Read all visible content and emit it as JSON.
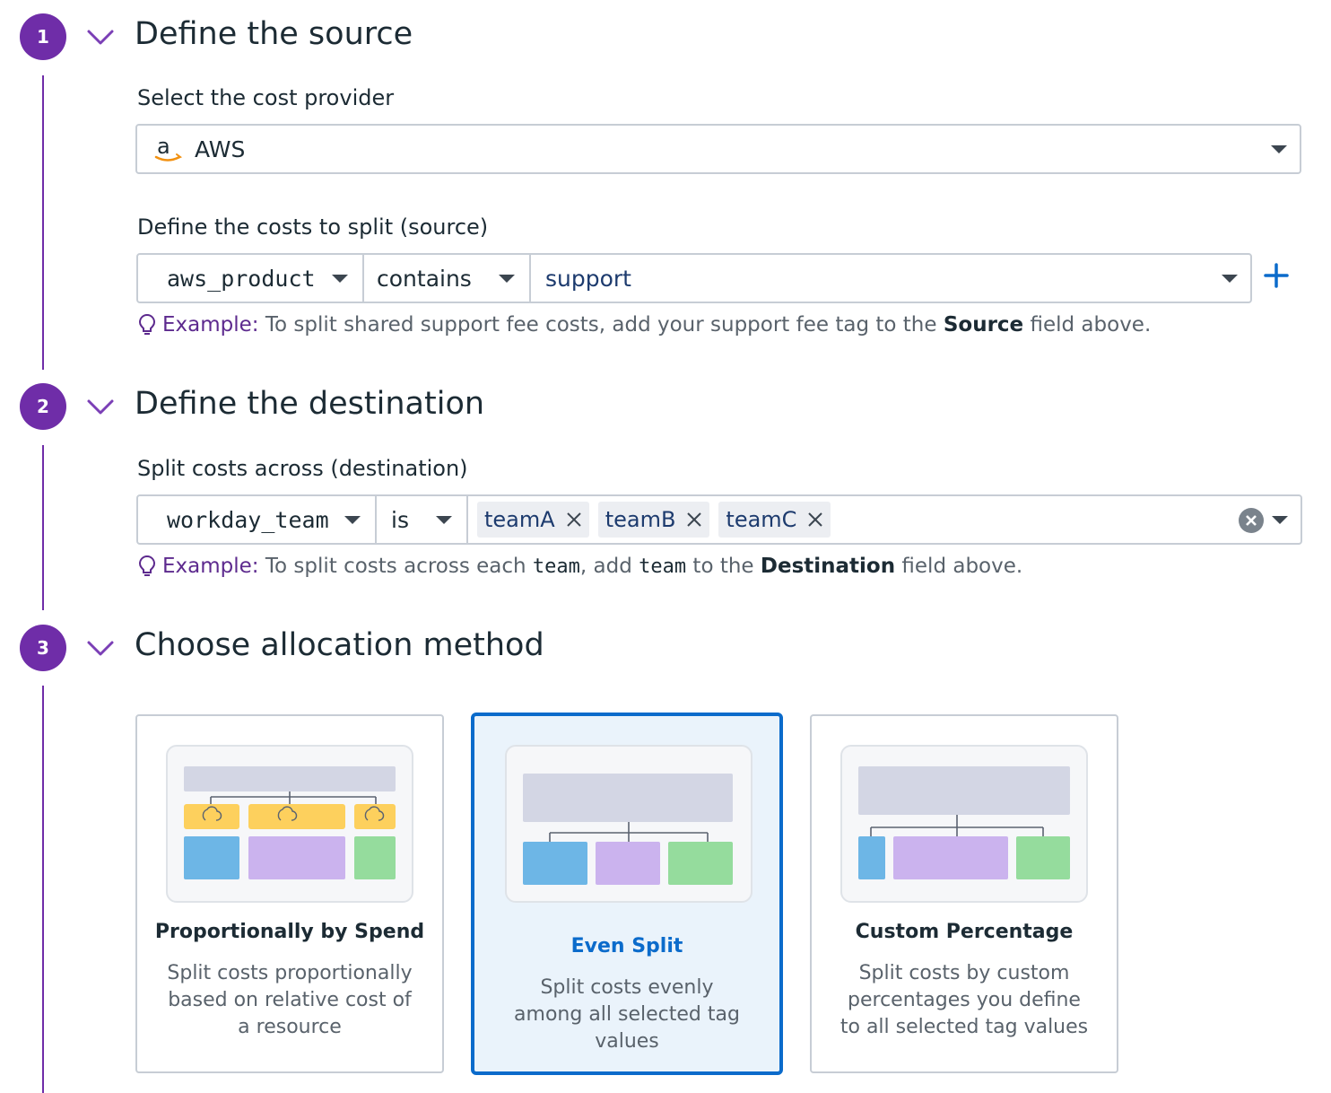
{
  "steps": [
    {
      "number": "1",
      "title": "Define the source"
    },
    {
      "number": "2",
      "title": "Define the destination"
    },
    {
      "number": "3",
      "title": "Choose allocation method"
    }
  ],
  "source": {
    "provider_label": "Select the cost provider",
    "provider_value": "AWS",
    "provider_icon": "amazon-logo-icon",
    "costs_label": "Define the costs to split (source)",
    "tag_key": "aws_product",
    "operator": "contains",
    "tag_value": "support",
    "hint_prefix": "Example:",
    "hint_text_1": "To split shared support fee costs, add your support fee tag to the",
    "hint_bold": "Source",
    "hint_text_2": "field above."
  },
  "destination": {
    "label": "Split costs across (destination)",
    "tag_key": "workday_team",
    "operator": "is",
    "values": [
      "teamA",
      "teamB",
      "teamC"
    ],
    "hint_prefix": "Example:",
    "hint_text_1": "To split costs across each",
    "hint_code_1": "team",
    "hint_text_2": ", add",
    "hint_code_2": "team",
    "hint_text_3": "to the",
    "hint_bold": "Destination",
    "hint_text_4": "field above."
  },
  "methods": [
    {
      "title": "Proportionally by Spend",
      "desc": "Split costs proportionally based on relative cost of a resource",
      "selected": false
    },
    {
      "title": "Even Split",
      "desc": "Split costs evenly among all selected tag values",
      "selected": true
    },
    {
      "title": "Custom Percentage",
      "desc": "Split costs by custom percentages you define to all selected tag values",
      "selected": false
    }
  ],
  "colors": {
    "accent_purple": "#6f2da8",
    "selected_blue": "#0b6bcb",
    "bar_blue": "#6db6e6",
    "bar_purple": "#cbb3ee",
    "bar_green": "#95dc9d",
    "bar_yellow": "#fdd05d",
    "header_gray": "#d3d6e4"
  }
}
